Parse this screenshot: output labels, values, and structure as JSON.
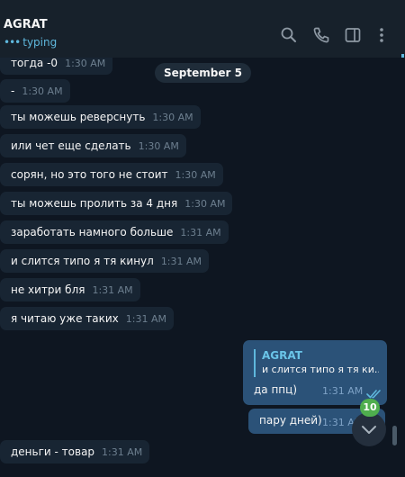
{
  "header": {
    "title": "AGRAT",
    "status": "typing",
    "status_dots": "•••",
    "icons": [
      "search-icon",
      "phone-icon",
      "sidebar-toggle-icon",
      "more-vert-icon"
    ]
  },
  "chat": {
    "date_separator": "September 5",
    "incoming": [
      {
        "text": "тогда -0",
        "time": "1:30 AM"
      },
      {
        "text": "-",
        "time": "1:30 AM"
      },
      {
        "text": "ты можешь реверснуть",
        "time": "1:30 AM"
      },
      {
        "text": "или чет еще сделать",
        "time": "1:30 AM"
      },
      {
        "text": "сорян, но это того не стоит",
        "time": "1:30 AM"
      },
      {
        "text": "ты можешь пролить за 4 дня",
        "time": "1:30 AM"
      },
      {
        "text": "заработать намного больше",
        "time": "1:31 AM"
      },
      {
        "text": "и слится типо я тя кинул",
        "time": "1:31 AM"
      },
      {
        "text": "не хитри бля",
        "time": "1:31 AM"
      },
      {
        "text": "я читаю уже таких",
        "time": "1:31 AM"
      },
      {
        "text": "деньги - товар",
        "time": "1:31 AM"
      }
    ],
    "outgoing_reply": {
      "quote_author": "AGRAT",
      "quote_text": "и слится типо я тя ки...",
      "text": "да ппц)",
      "time": "1:31 AM"
    },
    "outgoing": {
      "text": "пару дней)",
      "time": "1:31 AM"
    },
    "unread_count": "10"
  },
  "colors": {
    "background": "#0e1621",
    "header": "#17212b",
    "incoming_bubble": "#182533",
    "outgoing_bubble": "#2b5278",
    "accent": "#5fb8dd",
    "badge": "#4fae4e"
  }
}
